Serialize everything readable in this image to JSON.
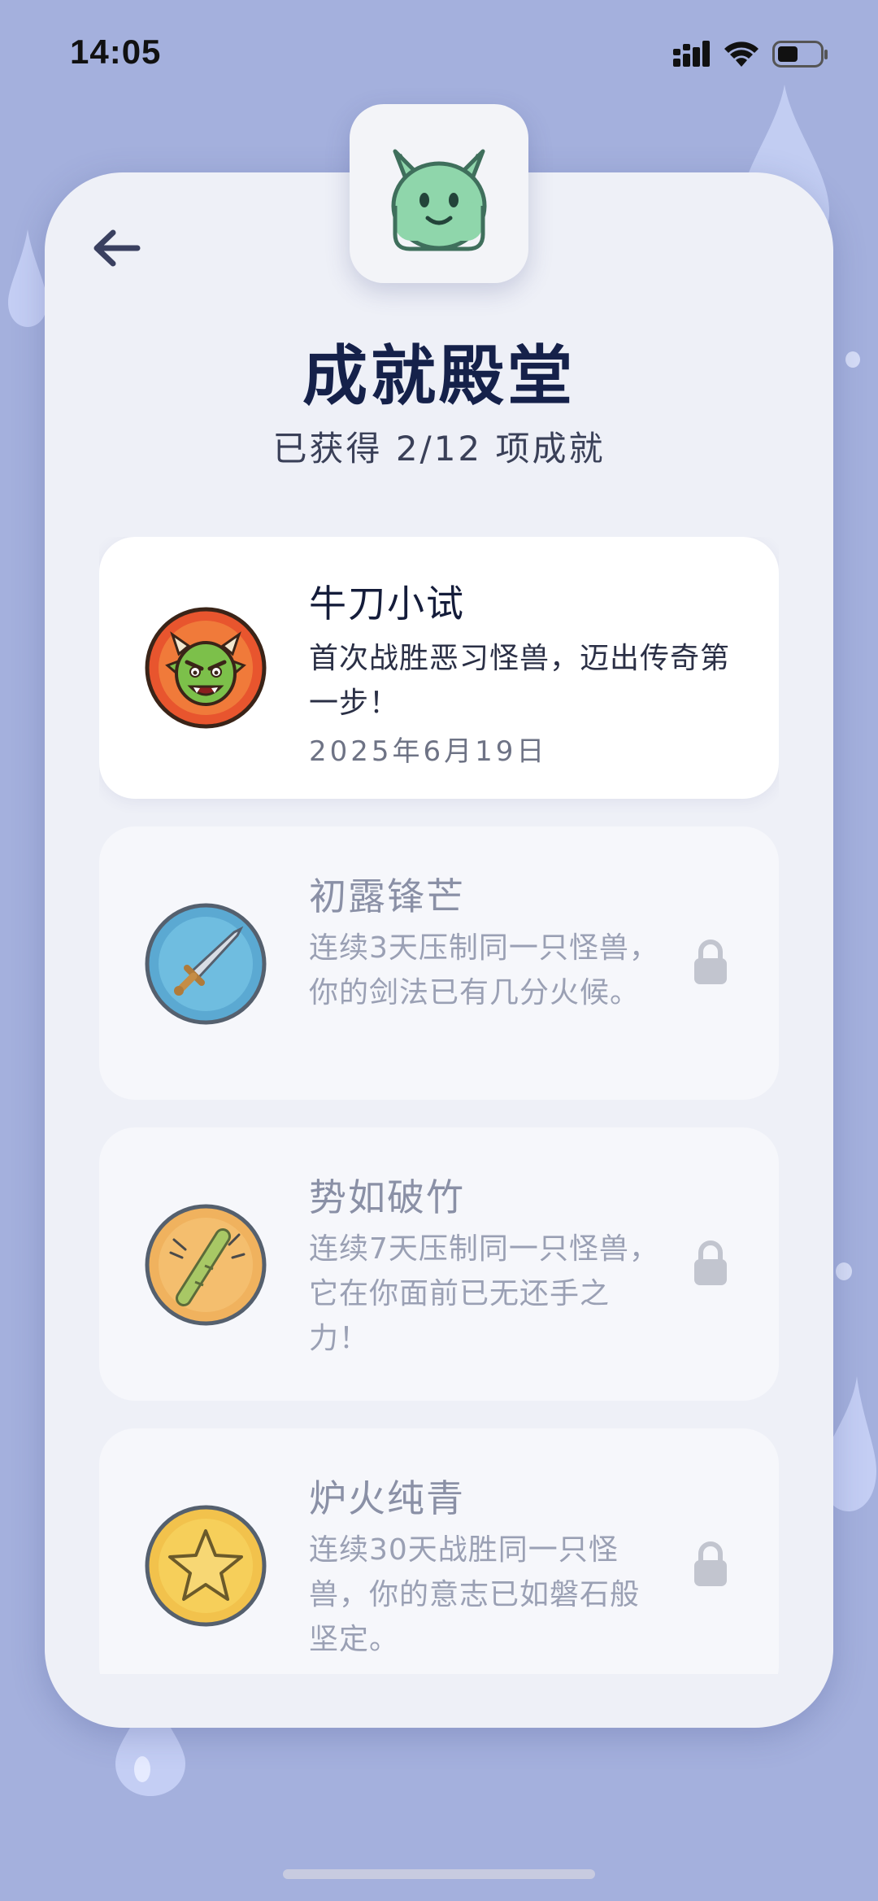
{
  "status_bar": {
    "time": "14:05"
  },
  "header": {
    "title": "成就殿堂",
    "subtitle": "已获得 2/12 项成就"
  },
  "achievements": [
    {
      "title": "牛刀小试",
      "description": "首次战胜恶习怪兽，迈出传奇第一步！",
      "date": "2025年6月19日",
      "unlocked": true,
      "icon": "monster-badge-icon"
    },
    {
      "title": "初露锋芒",
      "description": "连续3天压制同一只怪兽，你的剑法已有几分火候。",
      "unlocked": false,
      "icon": "sword-badge-icon"
    },
    {
      "title": "势如破竹",
      "description": "连续7天压制同一只怪兽，它在你面前已无还手之力！",
      "unlocked": false,
      "icon": "bamboo-badge-icon"
    },
    {
      "title": "炉火纯青",
      "description": "连续30天战胜同一只怪兽，你的意志已如磐石般坚定。",
      "unlocked": false,
      "icon": "star-badge-icon"
    }
  ],
  "colors": {
    "background": "#a4b0dd",
    "card": "#eef0f7",
    "title": "#15214a",
    "locked_text": "#8a90a6"
  }
}
